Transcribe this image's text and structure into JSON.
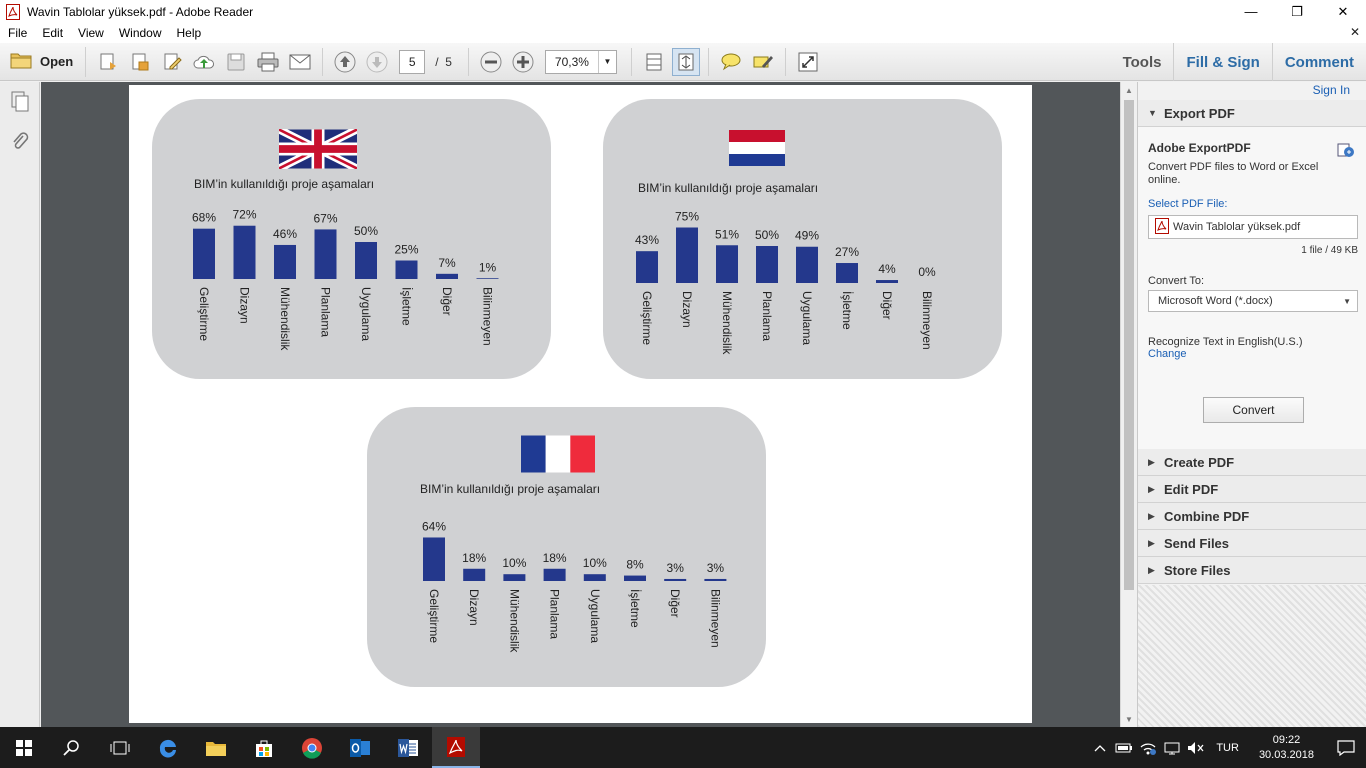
{
  "window": {
    "title": "Wavin Tablolar yüksek.pdf - Adobe Reader",
    "minimize": "—",
    "restore": "❐",
    "close": "✕"
  },
  "menu": {
    "items": [
      "File",
      "Edit",
      "View",
      "Window",
      "Help"
    ],
    "close": "✕"
  },
  "toolbar": {
    "open_label": "Open",
    "page_current": "5",
    "page_sep": "/",
    "page_total": "5",
    "zoom": "70,3%",
    "tabs": {
      "tools": "Tools",
      "fill_sign": "Fill & Sign",
      "comment": "Comment"
    }
  },
  "rightpane": {
    "sign_in": "Sign In",
    "export": {
      "header": "Export PDF",
      "title": "Adobe ExportPDF",
      "desc": "Convert PDF files to Word or Excel online.",
      "select_label": "Select PDF File:",
      "file_name": "Wavin Tablolar yüksek.pdf",
      "file_size": "1 file / 49 KB",
      "convert_to_label": "Convert To:",
      "convert_to_value": "Microsoft Word (*.docx)",
      "recognize": "Recognize Text in English(U.S.)",
      "change": "Change",
      "convert_button": "Convert"
    },
    "sections": [
      "Create PDF",
      "Edit PDF",
      "Combine PDF",
      "Send Files",
      "Store Files"
    ]
  },
  "taskbar": {
    "lang": "TUR",
    "time": "09:22",
    "date": "30.03.2018"
  },
  "colors": {
    "bar": "#24388c",
    "panel": "#d0d1d3",
    "link": "#1a5fb4",
    "doc_bg": "#525659"
  },
  "chart_data": [
    {
      "type": "bar",
      "title": "BIM’in kullanıldığı proje aşamaları",
      "flag": "uk-flag",
      "categories": [
        "Geliştirme",
        "Dizayn",
        "Mühendislik",
        "Planlama",
        "Uygulama",
        "İşletme",
        "Diğer",
        "Bilinmeyen"
      ],
      "values": [
        68,
        72,
        46,
        67,
        50,
        25,
        7,
        1
      ],
      "labels": [
        "68%",
        "72%",
        "46%",
        "67%",
        "50%",
        "25%",
        "7%",
        "1%"
      ],
      "ylim": [
        0,
        100
      ]
    },
    {
      "type": "bar",
      "title": "BIM’in kullanıldığı proje aşamaları",
      "flag": "netherlands-flag",
      "categories": [
        "Geliştirme",
        "Dizayn",
        "Mühendislik",
        "Planlama",
        "Uygulama",
        "İşletme",
        "Diğer",
        "Bilinmeyen"
      ],
      "values": [
        43,
        75,
        51,
        50,
        49,
        27,
        4,
        0
      ],
      "labels": [
        "43%",
        "75%",
        "51%",
        "50%",
        "49%",
        "27%",
        "4%",
        "0%"
      ],
      "ylim": [
        0,
        100
      ]
    },
    {
      "type": "bar",
      "title": "BIM’in kullanıldığı proje aşamaları",
      "flag": "france-flag",
      "categories": [
        "Geliştirme",
        "Dizayn",
        "Mühendislik",
        "Planlama",
        "Uygulama",
        "İşletme",
        "Diğer",
        "Bilinmeyen"
      ],
      "values": [
        64,
        18,
        10,
        18,
        10,
        8,
        3,
        3
      ],
      "labels": [
        "64%",
        "18%",
        "10%",
        "18%",
        "10%",
        "8%",
        "3%",
        "3%"
      ],
      "ylim": [
        0,
        100
      ]
    }
  ]
}
